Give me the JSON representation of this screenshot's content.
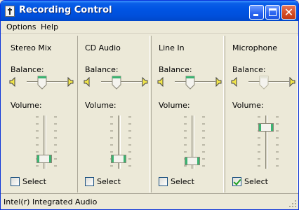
{
  "window": {
    "title": "Recording Control"
  },
  "menu": [
    {
      "label": "Options"
    },
    {
      "label": "Help"
    }
  ],
  "columns": [
    {
      "name": "Stereo Mix",
      "balance_label": "Balance:",
      "volume_label": "Volume:",
      "select_label": "Select",
      "selected": false,
      "volume_level": 0.1,
      "balance_level": 0.5
    },
    {
      "name": "CD Audio",
      "balance_label": "Balance:",
      "volume_label": "Volume:",
      "select_label": "Select",
      "selected": false,
      "volume_level": 0.1,
      "balance_level": 0.5
    },
    {
      "name": "Line In",
      "balance_label": "Balance:",
      "volume_label": "Volume:",
      "select_label": "Select",
      "selected": false,
      "volume_level": 0.05,
      "balance_level": 0.5
    },
    {
      "name": "Microphone",
      "balance_label": "Balance:",
      "volume_label": "Volume:",
      "select_label": "Select",
      "selected": true,
      "volume_level": 0.8,
      "balance_level": 0.5
    }
  ],
  "status": {
    "text": "Intel(r) Integrated Audio"
  },
  "colors": {
    "titlebar": "#0054e3",
    "window_bg": "#ece9d8",
    "thumb_active": "#3cb371",
    "thumb_disabled": "#e6e6d8",
    "checkmark": "#21a121"
  }
}
